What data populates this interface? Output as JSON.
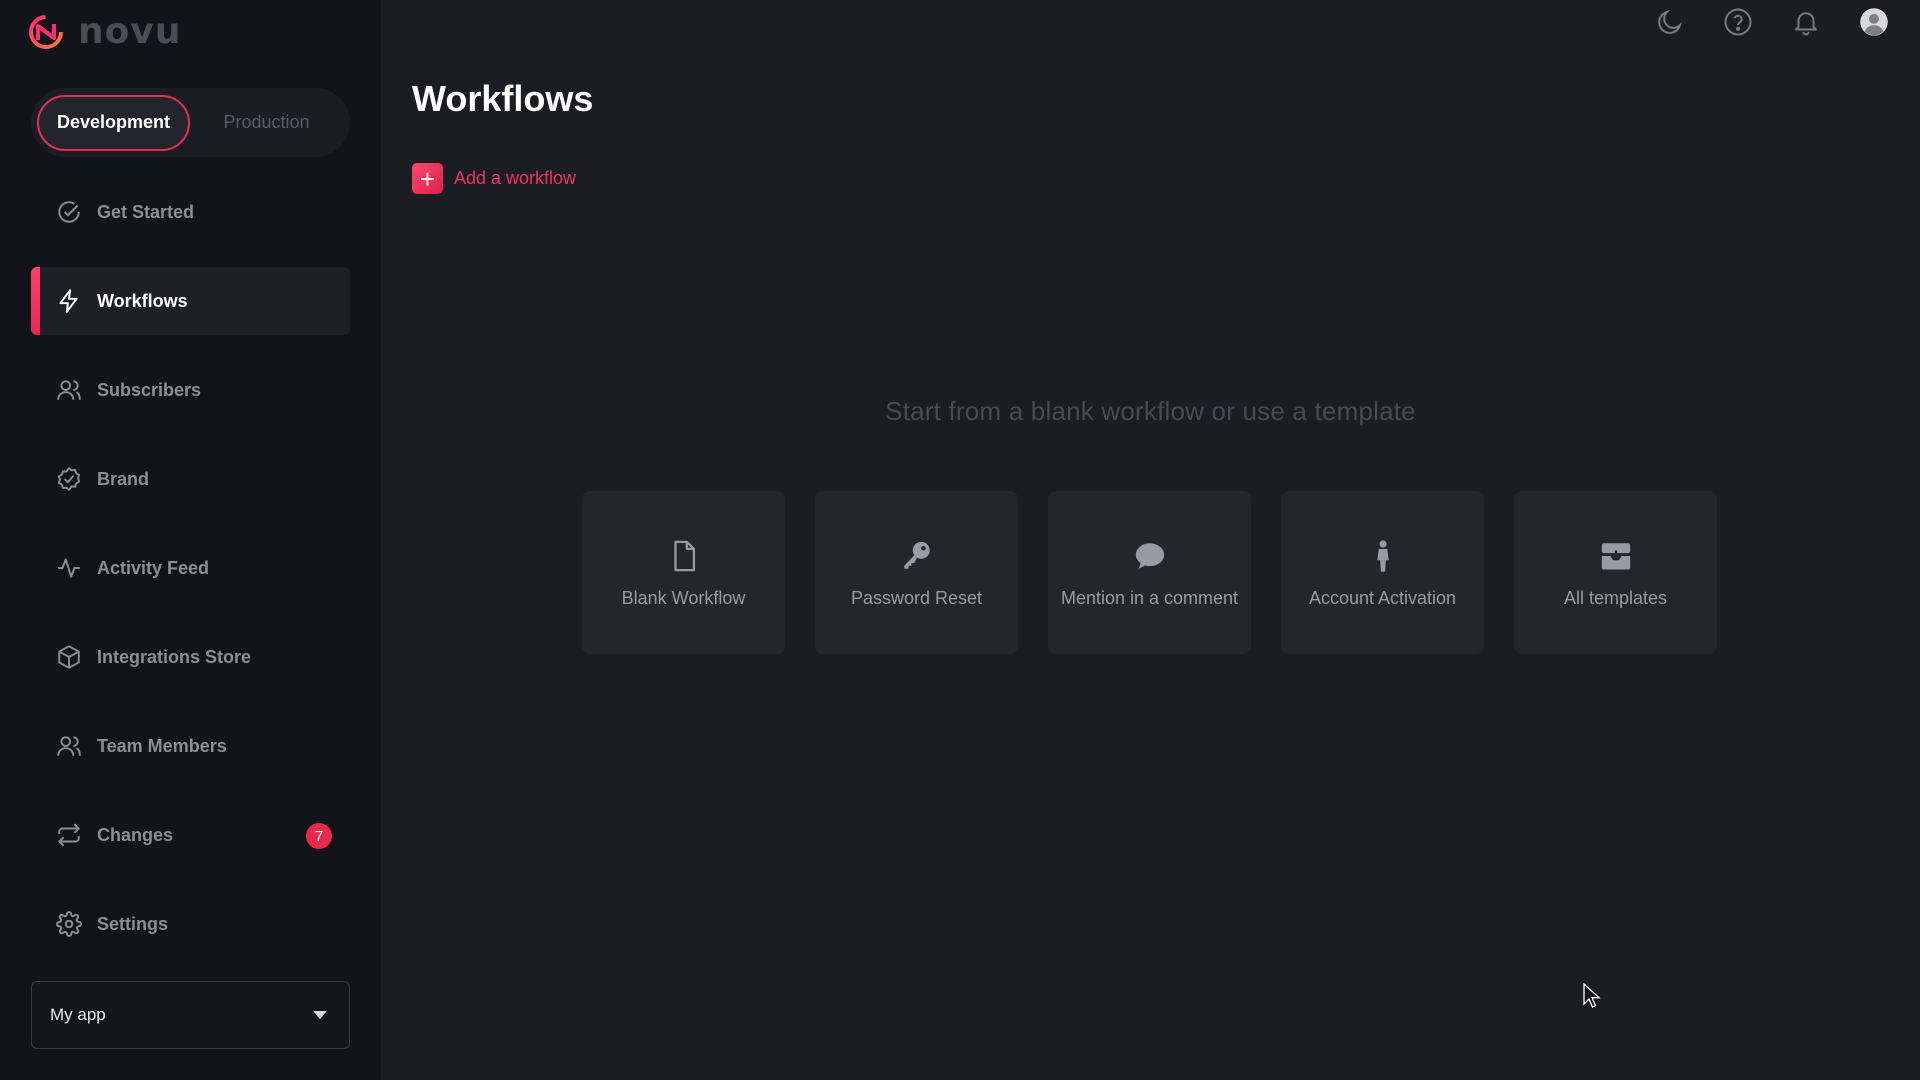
{
  "brand": {
    "name": "novu",
    "accent": "#e9355a"
  },
  "environment": {
    "options": [
      "Development",
      "Production"
    ],
    "selected": "Development"
  },
  "sidebar": {
    "items": [
      {
        "label": "Get Started",
        "icon": "check-circle-icon",
        "active": false
      },
      {
        "label": "Workflows",
        "icon": "bolt-icon",
        "active": true
      },
      {
        "label": "Subscribers",
        "icon": "users-icon",
        "active": false
      },
      {
        "label": "Brand",
        "icon": "badge-check-icon",
        "active": false
      },
      {
        "label": "Activity Feed",
        "icon": "activity-icon",
        "active": false
      },
      {
        "label": "Integrations Store",
        "icon": "box-icon",
        "active": false
      },
      {
        "label": "Team Members",
        "icon": "team-icon",
        "active": false
      },
      {
        "label": "Changes",
        "icon": "sync-icon",
        "active": false,
        "badge": "7"
      },
      {
        "label": "Settings",
        "icon": "gear-icon",
        "active": false
      }
    ],
    "app_select": {
      "value": "My app"
    }
  },
  "topbar": {
    "icons": [
      "moon-icon",
      "help-icon",
      "bell-icon",
      "avatar-icon"
    ]
  },
  "main": {
    "title": "Workflows",
    "add_workflow_label": "Add a workflow",
    "empty_hint": "Start from a blank workflow or use a template",
    "templates": [
      {
        "label": "Blank Workflow",
        "icon": "file-icon"
      },
      {
        "label": "Password Reset",
        "icon": "key-icon"
      },
      {
        "label": "Mention in a comment",
        "icon": "comment-icon"
      },
      {
        "label": "Account Activation",
        "icon": "person-icon"
      },
      {
        "label": "All templates",
        "icon": "templates-icon"
      }
    ]
  }
}
